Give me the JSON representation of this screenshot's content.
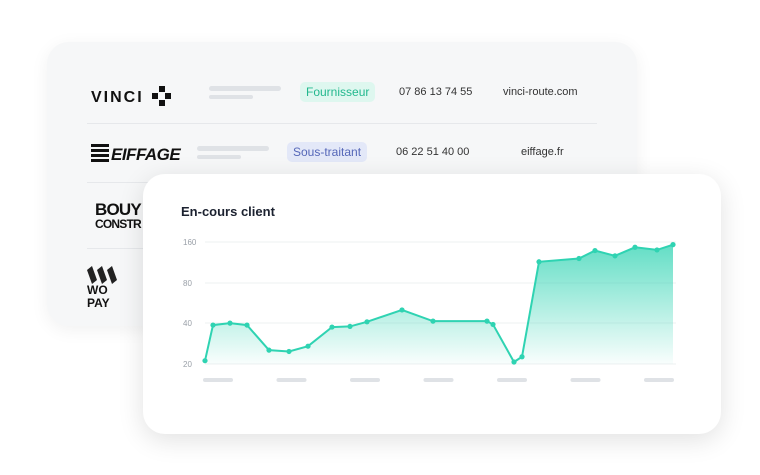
{
  "suppliers": [
    {
      "logo": "VINCI",
      "tag": "Fournisseur",
      "phone": "07 86 13 74 55",
      "site": "vinci-route.com"
    },
    {
      "logo": "EIFFAGE",
      "tag": "Sous-traitant",
      "phone": "06 22 51 40 00",
      "site": "eiffage.fr"
    },
    {
      "logo_line1": "BOUY",
      "logo_line2": "CONSTR"
    },
    {
      "logo_line1": "WO",
      "logo_line2": "PAY"
    }
  ],
  "colors": {
    "accent": "#2fd3b2",
    "tag_green_text": "#22b88e",
    "tag_blue_text": "#5567b8"
  },
  "chart_data": {
    "type": "area",
    "title": "En-cours client",
    "y_ticks": [
      "160",
      "80",
      "40",
      "20"
    ],
    "x_tick_labels": [],
    "series": [
      {
        "values": [
          5,
          59,
          62,
          59,
          21,
          19,
          27,
          56,
          57,
          64,
          82,
          65,
          65,
          60,
          3,
          11,
          155,
          160,
          172,
          164,
          177,
          173,
          181
        ]
      }
    ],
    "ylim": [
      0,
      185
    ],
    "grid": true,
    "legend": "none"
  }
}
